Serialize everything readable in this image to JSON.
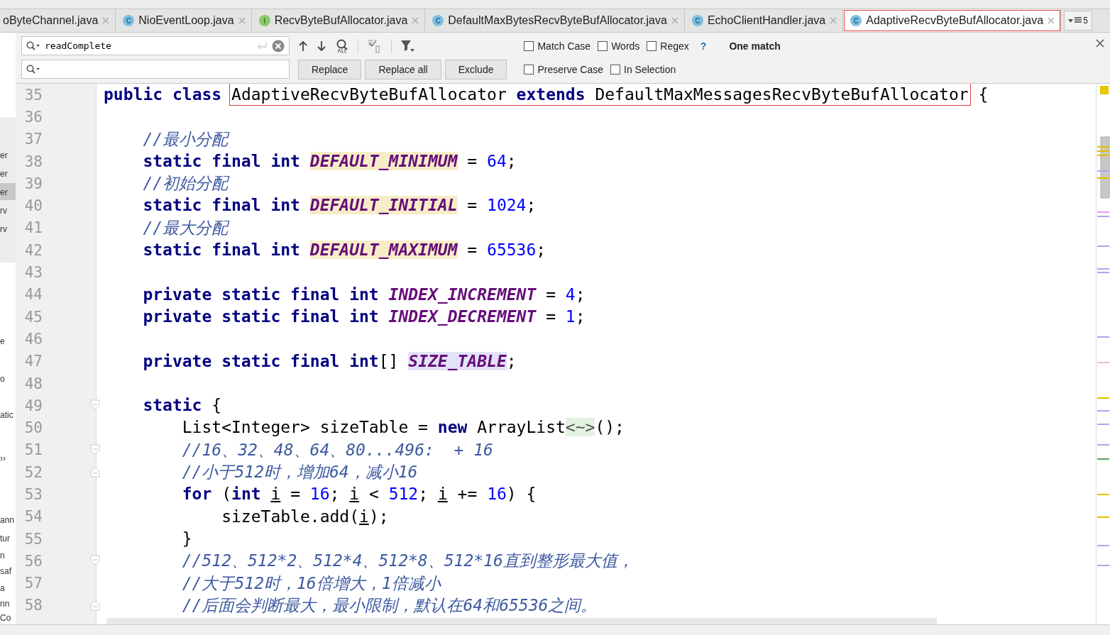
{
  "tabs": [
    {
      "label": "oByteChannel.java",
      "selected": false,
      "annotated": false
    },
    {
      "label": "NioEventLoop.java",
      "kind": "class",
      "icon": "C",
      "selected": false,
      "annotated": false
    },
    {
      "label": "RecvByteBufAllocator.java",
      "kind": "interface",
      "icon": "I",
      "selected": false,
      "annotated": false
    },
    {
      "label": "DefaultMaxBytesRecvByteBufAllocator.java",
      "kind": "class",
      "icon": "C",
      "selected": false,
      "annotated": false
    },
    {
      "label": "EchoClientHandler.java",
      "kind": "class",
      "icon": "C",
      "selected": false,
      "annotated": false
    },
    {
      "label": "AdaptiveRecvByteBufAllocator.java",
      "kind": "class",
      "icon": "C",
      "selected": true,
      "annotated": true
    }
  ],
  "tab_overflow": {
    "count": "5"
  },
  "side_panel_fragments": [
    "er",
    "er",
    "er",
    "rv",
    "rv",
    "e",
    "o",
    "atic",
    "››",
    "ann",
    "tur",
    "n",
    "saf",
    "a",
    "nn",
    "Co"
  ],
  "find_bar": {
    "search_value": "readComplete",
    "buttons": [
      "Replace",
      "Replace all",
      "Exclude"
    ],
    "options": [
      {
        "label": "Match Case",
        "checked": false
      },
      {
        "label": "Words",
        "checked": false
      },
      {
        "label": "Regex",
        "checked": false
      },
      {
        "label": "Preserve Case",
        "checked": false
      },
      {
        "label": "In Selection",
        "checked": false
      }
    ],
    "help": "?",
    "status": "One match"
  },
  "lines": [
    {
      "number": "35",
      "tokens": [
        {
          "kind": "kw",
          "t": "public "
        },
        {
          "kind": "kw",
          "t": "class "
        },
        {
          "kind": "plain",
          "t": "AdaptiveRecvByteBufAllocator ",
          "boxed": true
        },
        {
          "kind": "kw",
          "t": "extends ",
          "boxed": true
        },
        {
          "kind": "plain",
          "t": "DefaultMaxMessagesRecvByteBufAllocator",
          "boxed": true
        },
        {
          "kind": "plain",
          "t": " {"
        }
      ]
    },
    {
      "number": "36"
    },
    {
      "number": "37",
      "tokens": [
        {
          "kind": "cmt",
          "t": "    //最小分配"
        }
      ]
    },
    {
      "number": "38",
      "tokens": [
        {
          "kind": "kw",
          "t": "    static final int "
        },
        {
          "kind": "const",
          "t": "DEFAULT_MINIMUM",
          "color": "#f6edc8"
        },
        {
          "kind": "plain",
          "t": " = "
        },
        {
          "kind": "num",
          "t": "64"
        },
        {
          "kind": "plain",
          "t": ";"
        }
      ]
    },
    {
      "number": "39",
      "tokens": [
        {
          "kind": "cmt",
          "t": "    //初始分配"
        }
      ]
    },
    {
      "number": "40",
      "tokens": [
        {
          "kind": "kw",
          "t": "    static final int "
        },
        {
          "kind": "const",
          "t": "DEFAULT_INITIAL",
          "color": "#f6edc8"
        },
        {
          "kind": "plain",
          "t": " = "
        },
        {
          "kind": "num",
          "t": "1024"
        },
        {
          "kind": "plain",
          "t": ";"
        }
      ]
    },
    {
      "number": "41",
      "tokens": [
        {
          "kind": "cmt",
          "t": "    //最大分配"
        }
      ]
    },
    {
      "number": "42",
      "tokens": [
        {
          "kind": "kw",
          "t": "    static final int "
        },
        {
          "kind": "const",
          "t": "DEFAULT_MAXIMUM",
          "color": "#f6edc8"
        },
        {
          "kind": "plain",
          "t": " = "
        },
        {
          "kind": "num",
          "t": "65536"
        },
        {
          "kind": "plain",
          "t": ";"
        }
      ]
    },
    {
      "number": "43"
    },
    {
      "number": "44",
      "tokens": [
        {
          "kind": "kw",
          "t": "    private static final int "
        },
        {
          "kind": "const",
          "t": "INDEX_INCREMENT"
        },
        {
          "kind": "plain",
          "t": " = "
        },
        {
          "kind": "num",
          "t": "4"
        },
        {
          "kind": "plain",
          "t": ";"
        }
      ]
    },
    {
      "number": "45",
      "tokens": [
        {
          "kind": "kw",
          "t": "    private static final int "
        },
        {
          "kind": "const",
          "t": "INDEX_DECREMENT"
        },
        {
          "kind": "plain",
          "t": " = "
        },
        {
          "kind": "num",
          "t": "1"
        },
        {
          "kind": "plain",
          "t": ";"
        }
      ]
    },
    {
      "number": "46"
    },
    {
      "number": "47",
      "tokens": [
        {
          "kind": "kw",
          "t": "    private static final int"
        },
        {
          "kind": "plain",
          "t": "[] "
        },
        {
          "kind": "const",
          "t": "SIZE_TABLE",
          "color": "#e2e2f8"
        },
        {
          "kind": "plain",
          "t": ";"
        }
      ]
    },
    {
      "number": "48"
    },
    {
      "number": "49",
      "fold": {
        "kind": "start"
      },
      "tokens": [
        {
          "kind": "kw",
          "t": "    static"
        },
        {
          "kind": "plain",
          "t": " {"
        }
      ]
    },
    {
      "number": "50",
      "tokens": [
        {
          "kind": "plain",
          "t": "        List<Integer> sizeTable = "
        },
        {
          "kind": "kw",
          "t": "new"
        },
        {
          "kind": "plain",
          "t": " ArrayList"
        },
        {
          "kind": "diamond",
          "t": "<~>"
        },
        {
          "kind": "plain",
          "t": "();"
        }
      ]
    },
    {
      "number": "51",
      "fold": {
        "kind": "start"
      },
      "tokens": [
        {
          "kind": "cmt",
          "t": "        //16、32、48、64、80...496:  + 16"
        }
      ]
    },
    {
      "number": "52",
      "fold": {
        "kind": "end"
      },
      "tokens": [
        {
          "kind": "cmt",
          "t": "        //小于512时，增加64，减小16"
        }
      ]
    },
    {
      "number": "53",
      "tokens": [
        {
          "kind": "kw",
          "t": "        for"
        },
        {
          "kind": "plain",
          "t": " ("
        },
        {
          "kind": "kw",
          "t": "int "
        },
        {
          "kind": "var",
          "t": "i"
        },
        {
          "kind": "plain",
          "t": " = "
        },
        {
          "kind": "num",
          "t": "16"
        },
        {
          "kind": "plain",
          "t": "; "
        },
        {
          "kind": "var",
          "t": "i"
        },
        {
          "kind": "plain",
          "t": " < "
        },
        {
          "kind": "num",
          "t": "512"
        },
        {
          "kind": "plain",
          "t": "; "
        },
        {
          "kind": "var",
          "t": "i"
        },
        {
          "kind": "plain",
          "t": " += "
        },
        {
          "kind": "num",
          "t": "16"
        },
        {
          "kind": "plain",
          "t": ") {"
        }
      ]
    },
    {
      "number": "54",
      "tokens": [
        {
          "kind": "plain",
          "t": "            sizeTable.add("
        },
        {
          "kind": "var",
          "t": "i"
        },
        {
          "kind": "plain",
          "t": ");"
        }
      ]
    },
    {
      "number": "55",
      "tokens": [
        {
          "kind": "plain",
          "t": "        }"
        }
      ]
    },
    {
      "number": "56",
      "fold": {
        "kind": "start"
      },
      "tokens": [
        {
          "kind": "cmt",
          "t": "        //512、512*2、512*4、512*8、512*16直到整形最大值，"
        }
      ]
    },
    {
      "number": "57",
      "tokens": [
        {
          "kind": "cmt",
          "t": "        //大于512时，16倍增大，1倍减小"
        }
      ]
    },
    {
      "number": "58",
      "fold": {
        "kind": "end"
      },
      "tokens": [
        {
          "kind": "cmt",
          "t": "        //后面会判断最大，最小限制，默认在64和65536之间。"
        }
      ]
    }
  ]
}
